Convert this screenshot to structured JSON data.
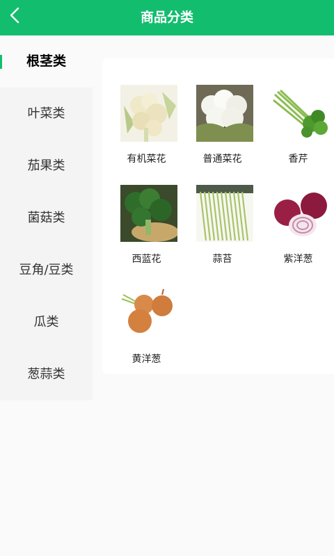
{
  "header": {
    "title": "商品分类"
  },
  "sidebar": {
    "items": [
      {
        "label": "根茎类"
      },
      {
        "label": "叶菜类"
      },
      {
        "label": "茄果类"
      },
      {
        "label": "菌菇类"
      },
      {
        "label": "豆角/豆类"
      },
      {
        "label": "瓜类"
      },
      {
        "label": "葱蒜类"
      }
    ],
    "active_index": 0
  },
  "products": [
    {
      "name": "有机菜花",
      "image": "cauliflower-organic"
    },
    {
      "name": "普通菜花",
      "image": "cauliflower"
    },
    {
      "name": "香芹",
      "image": "celery"
    },
    {
      "name": "西蓝花",
      "image": "broccoli"
    },
    {
      "name": "蒜苔",
      "image": "garlic-scape"
    },
    {
      "name": "紫洋葱",
      "image": "red-onion"
    },
    {
      "name": "黄洋葱",
      "image": "yellow-onion"
    }
  ],
  "colors": {
    "accent": "#13bd6e",
    "sidebar_bg": "#f4f4f4"
  }
}
